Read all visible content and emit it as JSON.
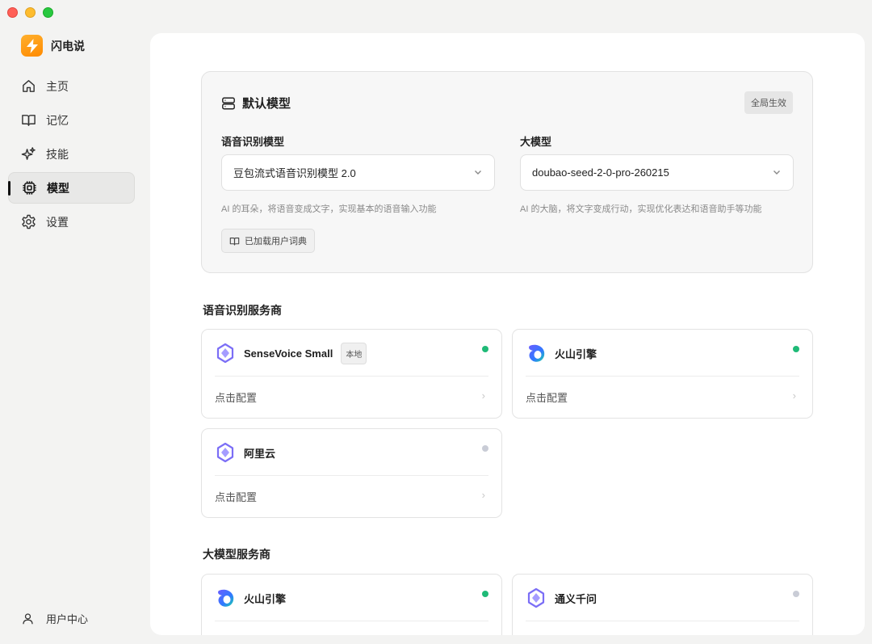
{
  "app": {
    "name": "闪电说"
  },
  "sidebar": {
    "items": [
      {
        "label": "主页",
        "icon": "home-icon"
      },
      {
        "label": "记忆",
        "icon": "book-icon"
      },
      {
        "label": "技能",
        "icon": "sparkle-icon"
      },
      {
        "label": "模型",
        "icon": "chip-icon",
        "active": true
      },
      {
        "label": "设置",
        "icon": "gear-icon"
      }
    ],
    "user_center": "用户中心"
  },
  "default_model": {
    "title": "默认模型",
    "badge": "全局生效",
    "asr": {
      "label": "语音识别模型",
      "value": "豆包流式语音识别模型 2.0",
      "hint": "AI 的耳朵，将语音变成文字，实现基本的语音输入功能"
    },
    "llm": {
      "label": "大模型",
      "value": "doubao-seed-2-0-pro-260215",
      "hint": "AI 的大脑，将文字变成行动，实现优化表达和语音助手等功能"
    },
    "dict_button": "已加载用户词典"
  },
  "asr_providers": {
    "title": "语音识别服务商",
    "items": [
      {
        "name": "SenseVoice Small",
        "tag": "本地",
        "status": "active",
        "config": "点击配置",
        "icon": "sensevoice-icon"
      },
      {
        "name": "火山引擎",
        "status": "active",
        "config": "点击配置",
        "icon": "volcengine-icon"
      },
      {
        "name": "阿里云",
        "status": "inactive",
        "config": "点击配置",
        "icon": "aliyun-icon"
      }
    ]
  },
  "llm_providers": {
    "title": "大模型服务商",
    "items": [
      {
        "name": "火山引擎",
        "status": "active",
        "icon": "volcengine-icon"
      },
      {
        "name": "通义千问",
        "status": "inactive",
        "icon": "qwen-icon"
      }
    ]
  },
  "colors": {
    "active": "#1fba77",
    "inactive": "#c9ccd6",
    "brand": "#ff9a1a"
  }
}
